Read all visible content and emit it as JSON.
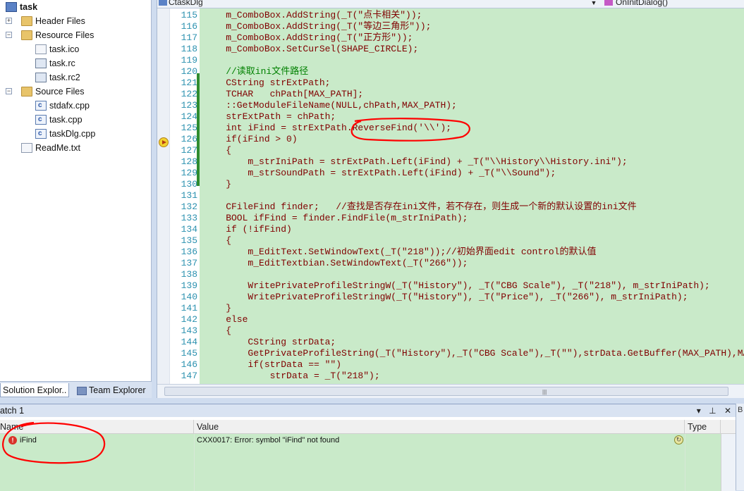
{
  "solution_explorer": {
    "items": [
      {
        "label": "task",
        "icon": "project-icon",
        "bold": true
      },
      {
        "label": "Header Files",
        "icon": "folder-icon"
      },
      {
        "label": "Resource Files",
        "icon": "folder-icon"
      },
      {
        "label": "task.ico",
        "icon": "icon-file-icon"
      },
      {
        "label": "task.rc",
        "icon": "rc-file-icon"
      },
      {
        "label": "task.rc2",
        "icon": "rc-file-icon"
      },
      {
        "label": "Source Files",
        "icon": "folder-icon"
      },
      {
        "label": "stdafx.cpp",
        "icon": "cpp-file-icon"
      },
      {
        "label": "task.cpp",
        "icon": "cpp-file-icon"
      },
      {
        "label": "taskDlg.cpp",
        "icon": "cpp-file-icon"
      },
      {
        "label": "ReadMe.txt",
        "icon": "text-file-icon"
      }
    ],
    "tabs": [
      "Solution Explor..",
      "Team Explorer"
    ]
  },
  "editor": {
    "class_combo": "CtaskDlg",
    "member_combo": "OnInitDialog()",
    "lines": [
      {
        "n": "115",
        "t": "    m_ComboBox.AddString(_T(\"点卡相关\"));",
        "c": ""
      },
      {
        "n": "116",
        "t": "    m_ComboBox.AddString(_T(\"等边三角形\"));",
        "c": ""
      },
      {
        "n": "117",
        "t": "    m_ComboBox.AddString(_T(\"正方形\"));",
        "c": ""
      },
      {
        "n": "118",
        "t": "    m_ComboBox.SetCurSel(SHAPE_CIRCLE);",
        "c": ""
      },
      {
        "n": "119",
        "t": "",
        "c": ""
      },
      {
        "n": "120",
        "t": "    //读取ini文件路径",
        "c": "cm"
      },
      {
        "n": "121",
        "t": "    CString strExtPath;",
        "c": ""
      },
      {
        "n": "122",
        "t": "    TCHAR   chPath[MAX_PATH];",
        "c": ""
      },
      {
        "n": "123",
        "t": "    ::GetModuleFileName(NULL,chPath,MAX_PATH);",
        "c": ""
      },
      {
        "n": "124",
        "t": "    strExtPath = chPath;",
        "c": ""
      },
      {
        "n": "125",
        "t": "    int iFind = strExtPath.ReverseFind('\\\\');",
        "c": ""
      },
      {
        "n": "126",
        "t": "    if(iFind > 0)",
        "c": ""
      },
      {
        "n": "127",
        "t": "    {",
        "c": ""
      },
      {
        "n": "128",
        "t": "        m_strIniPath = strExtPath.Left(iFind) + _T(\"\\\\History\\\\History.ini\");",
        "c": ""
      },
      {
        "n": "129",
        "t": "        m_strSoundPath = strExtPath.Left(iFind) + _T(\"\\\\Sound\");",
        "c": ""
      },
      {
        "n": "130",
        "t": "    }",
        "c": ""
      },
      {
        "n": "131",
        "t": "",
        "c": ""
      },
      {
        "n": "132",
        "t": "    CFileFind finder;   //查找是否存在ini文件，若不存在，则生成一个新的默认设置的ini文件",
        "c": ""
      },
      {
        "n": "133",
        "t": "    BOOL ifFind = finder.FindFile(m_strIniPath);",
        "c": ""
      },
      {
        "n": "134",
        "t": "    if (!ifFind)",
        "c": ""
      },
      {
        "n": "135",
        "t": "    {",
        "c": ""
      },
      {
        "n": "136",
        "t": "        m_EditText.SetWindowText(_T(\"218\"));//初始界面edit control的默认值",
        "c": ""
      },
      {
        "n": "137",
        "t": "        m_EditTextbian.SetWindowText(_T(\"266\"));",
        "c": ""
      },
      {
        "n": "138",
        "t": "",
        "c": ""
      },
      {
        "n": "139",
        "t": "        WritePrivateProfileStringW(_T(\"History\"), _T(\"CBG Scale\"), _T(\"218\"), m_strIniPath);",
        "c": ""
      },
      {
        "n": "140",
        "t": "        WritePrivateProfileStringW(_T(\"History\"), _T(\"Price\"), _T(\"266\"), m_strIniPath);",
        "c": ""
      },
      {
        "n": "141",
        "t": "    }",
        "c": ""
      },
      {
        "n": "142",
        "t": "    else",
        "c": ""
      },
      {
        "n": "143",
        "t": "    {",
        "c": ""
      },
      {
        "n": "144",
        "t": "        CString strData;",
        "c": ""
      },
      {
        "n": "145",
        "t": "        GetPrivateProfileString(_T(\"History\"),_T(\"CBG Scale\"),_T(\"\"),strData.GetBuffer(MAX_PATH),MAX_PATH,m_strIniPath);",
        "c": ""
      },
      {
        "n": "146",
        "t": "        if(strData == \"\")",
        "c": ""
      },
      {
        "n": "147",
        "t": "            strData = _T(\"218\");",
        "c": ""
      }
    ]
  },
  "watch": {
    "title": "atch 1",
    "columns": [
      "Name",
      "Value",
      "Type"
    ],
    "rows": [
      {
        "name": "iFind",
        "value": "CXX0017: Error: symbol \"iFind\" not found",
        "type": ""
      }
    ]
  },
  "side_panel": {
    "title": "B"
  },
  "colors": {
    "code_bg": "#c9eac9",
    "annotation": "#ff0000"
  }
}
